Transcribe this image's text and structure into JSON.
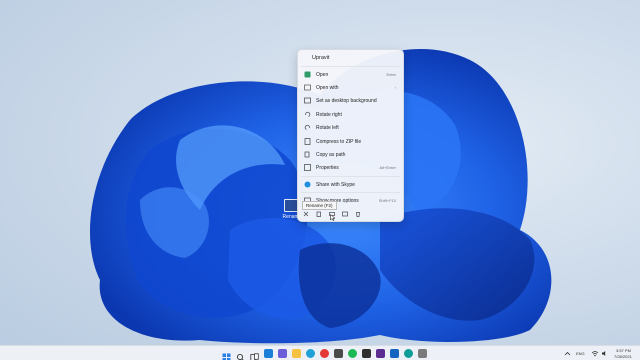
{
  "desktop": {
    "icon_label": "Rename",
    "wallpaper_colors": [
      "#0b3fc4",
      "#1f6ef0",
      "#3d8bff",
      "#0a2c8f"
    ]
  },
  "context_menu": {
    "title": "Upravit",
    "items": [
      {
        "label": "Open",
        "shortcut": "Enter",
        "icon": "image-icon"
      },
      {
        "label": "Open with",
        "shortcut": "›",
        "icon": "open-with-icon"
      },
      {
        "label": "Set as desktop background",
        "shortcut": "",
        "icon": "wallpaper-icon"
      },
      {
        "label": "Rotate right",
        "shortcut": "",
        "icon": "rotate-right-icon"
      },
      {
        "label": "Rotate left",
        "shortcut": "",
        "icon": "rotate-left-icon"
      },
      {
        "label": "Compress to ZIP file",
        "shortcut": "",
        "icon": "zip-icon"
      },
      {
        "label": "Copy as path",
        "shortcut": "",
        "icon": "copy-path-icon"
      },
      {
        "label": "Properties",
        "shortcut": "Alt+Enter",
        "icon": "properties-icon"
      },
      {
        "label": "Share with Skype",
        "shortcut": "",
        "icon": "skype-icon"
      },
      {
        "label": "Show more options",
        "shortcut": "Shift+F10",
        "icon": "more-options-icon"
      }
    ],
    "bottom_icons": [
      "cut-icon",
      "copy-icon",
      "rename-icon",
      "share-icon",
      "delete-icon"
    ],
    "tooltip": "Rename (F2)"
  },
  "taskbar": {
    "icons": [
      "start-icon",
      "search-icon",
      "task-view-icon",
      "widgets-icon",
      "chat-icon",
      "file-explorer-icon",
      "edge-icon",
      "store-icon",
      "opera-icon",
      "photos-icon",
      "spotify-icon",
      "terminal-icon",
      "vs-icon",
      "app-icon",
      "settings-icon"
    ],
    "tray": {
      "language": "ENG",
      "time": "3:57 PM",
      "date": "7/28/2021"
    }
  }
}
